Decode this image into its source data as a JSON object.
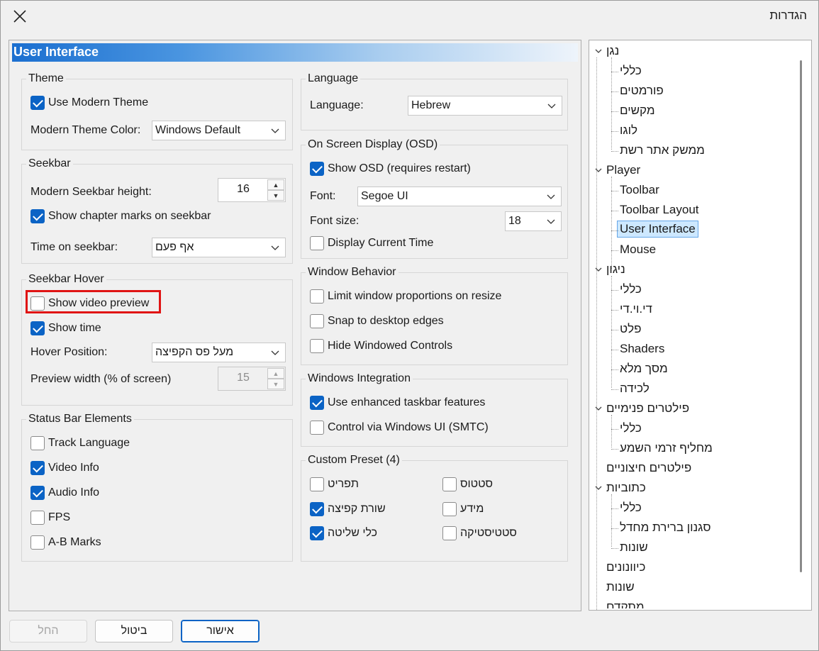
{
  "window": {
    "title": "הגדרות"
  },
  "panel": {
    "banner": "User Interface",
    "theme": {
      "title": "Theme",
      "use_modern_theme": {
        "label": "Use Modern Theme",
        "checked": true
      },
      "color_label": "Modern Theme Color:",
      "color_value": "Windows Default"
    },
    "seekbar": {
      "title": "Seekbar",
      "height_label": "Modern Seekbar height:",
      "height_value": "16",
      "chapter_marks": {
        "label": "Show chapter marks on seekbar",
        "checked": true
      },
      "time_label": "Time on seekbar:",
      "time_value": "אף פעם"
    },
    "seekbar_hover": {
      "title": "Seekbar Hover",
      "show_preview": {
        "label": "Show video preview",
        "checked": false
      },
      "show_time": {
        "label": "Show time",
        "checked": true
      },
      "position_label": "Hover Position:",
      "position_value": "מעל פס הקפיצה",
      "preview_width_label": "Preview width (% of screen)",
      "preview_width_value": "15"
    },
    "status_bar": {
      "title": "Status Bar Elements",
      "items": [
        {
          "label": "Track Language",
          "checked": false
        },
        {
          "label": "Video Info",
          "checked": true
        },
        {
          "label": "Audio Info",
          "checked": true
        },
        {
          "label": "FPS",
          "checked": false
        },
        {
          "label": "A-B Marks",
          "checked": false
        }
      ]
    },
    "language": {
      "title": "Language",
      "label": "Language:",
      "value": "Hebrew"
    },
    "osd": {
      "title": "On Screen Display (OSD)",
      "show_osd": {
        "label": "Show OSD (requires restart)",
        "checked": true
      },
      "font_label": "Font:",
      "font_value": "Segoe UI",
      "size_label": "Font size:",
      "size_value": "18",
      "current_time": {
        "label": "Display Current Time",
        "checked": false
      }
    },
    "window_behavior": {
      "title": "Window Behavior",
      "items": [
        {
          "label": "Limit window proportions on resize",
          "checked": false
        },
        {
          "label": "Snap to desktop edges",
          "checked": false
        },
        {
          "label": "Hide Windowed Controls",
          "checked": false
        }
      ]
    },
    "windows_integration": {
      "title": "Windows Integration",
      "items": [
        {
          "label": "Use enhanced taskbar features",
          "checked": true
        },
        {
          "label": "Control via Windows UI (SMTC)",
          "checked": false
        }
      ]
    },
    "custom_preset": {
      "title": "Custom Preset (4)",
      "left": [
        {
          "label": "תפריט",
          "checked": false
        },
        {
          "label": "שורת קפיצה",
          "checked": true
        },
        {
          "label": "כלי שליטה",
          "checked": true
        }
      ],
      "right": [
        {
          "label": "סטטוס",
          "checked": false
        },
        {
          "label": "מידע",
          "checked": false
        },
        {
          "label": "סטטיסטיקה",
          "checked": false
        }
      ]
    }
  },
  "tree": {
    "nodes": [
      "נגן",
      "כללי",
      "פורמטים",
      "מקשים",
      "לוגו",
      "ממשק אתר רשת",
      "Player",
      "Toolbar",
      "Toolbar Layout",
      "User Interface",
      "Mouse",
      "ניגון",
      "כללי",
      "די.וי.די",
      "פלט",
      "Shaders",
      "מסך מלא",
      "לכידה",
      "פילטרים פנימיים",
      "כללי",
      "מחליף זרמי השמע",
      "פילטרים חיצוניים",
      "כתוביות",
      "כללי",
      "סגנון ברירת מחדל",
      "שונות",
      "כיוונונים",
      "שונות",
      "מתקדם"
    ]
  },
  "buttons": {
    "ok": "אישור",
    "cancel": "ביטול",
    "apply": "החל"
  },
  "colors": {
    "accent": "#0b63c5",
    "highlight": "#e01414"
  }
}
